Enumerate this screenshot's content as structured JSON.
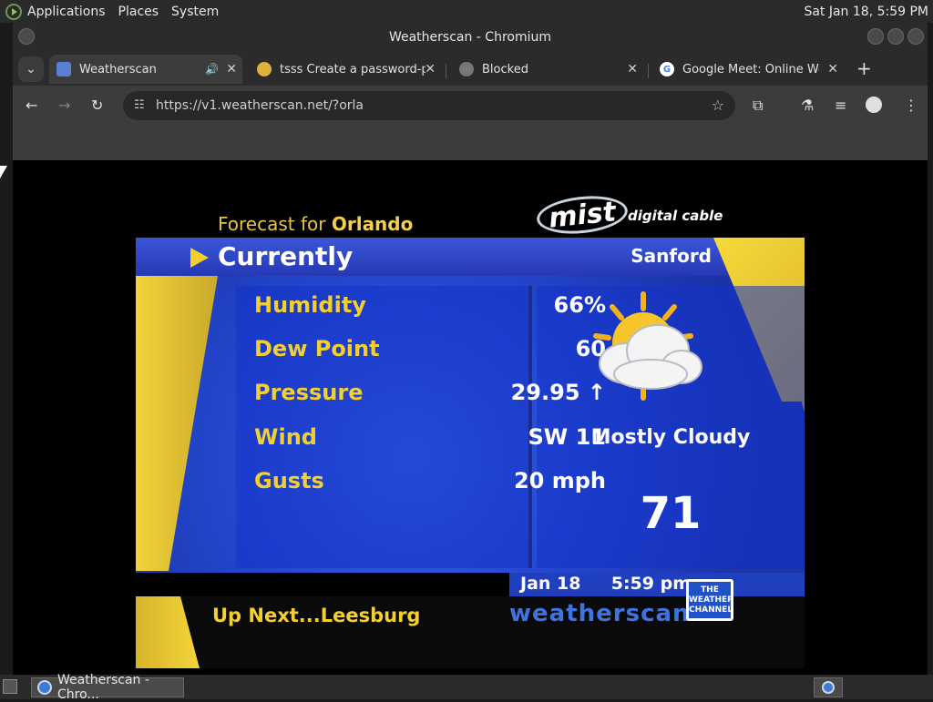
{
  "system_panel": {
    "menus": [
      "Applications",
      "Places",
      "System"
    ],
    "clock": "Sat Jan 18,  5:59 PM"
  },
  "window": {
    "title": "Weatherscan - Chromium"
  },
  "tabs": [
    {
      "title": "Weatherscan",
      "active": true,
      "audio": true
    },
    {
      "title": "tsss Create a password-pro",
      "active": false,
      "audio": false
    },
    {
      "title": "Blocked",
      "active": false,
      "audio": false
    },
    {
      "title": "Google Meet: Online Web",
      "active": false,
      "audio": false
    }
  ],
  "tab_controls": {
    "new_tab": "+",
    "tab_search": "⌄",
    "close": "✕",
    "audio": "🔊"
  },
  "toolbar": {
    "url": "https://v1.weatherscan.net/?orla"
  },
  "weatherscan": {
    "forecast_prefix": "Forecast for ",
    "forecast_city": "Orlando",
    "mist_logo": "mist",
    "mist_tag": "digital cable",
    "currently_label": "Currently",
    "current_city": "Sanford",
    "rows": [
      {
        "label": "Humidity",
        "value": "66%"
      },
      {
        "label": "Dew Point",
        "value": "60"
      },
      {
        "label": "Pressure",
        "value": "29.95 ↑"
      },
      {
        "label": "Wind",
        "value": "SW 11"
      },
      {
        "label": "Gusts",
        "value": "20 mph"
      }
    ],
    "condition": "Mostly Cloudy",
    "temperature": "71",
    "date": "Jan 18",
    "time": "5:59 pm",
    "up_next": "Up Next...Leesburg",
    "brand": "weatherscan",
    "twc_logo": "THE WEATHER CHANNEL"
  },
  "taskbar": {
    "task_title": "Weatherscan - Chro..."
  },
  "colors": {
    "accent_yellow": "#f4cf30",
    "ws_blue": "#2448cf",
    "brand_blue": "#3f74e0"
  }
}
